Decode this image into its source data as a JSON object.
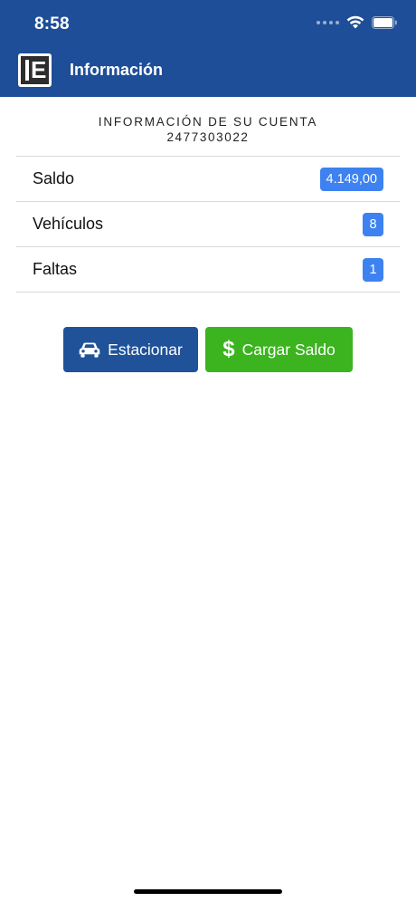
{
  "status_bar": {
    "time": "8:58"
  },
  "app_bar": {
    "title": "Información",
    "logo_letter": "E"
  },
  "account": {
    "label": "INFORMACIÓN DE SU CUENTA",
    "number": "2477303022"
  },
  "rows": [
    {
      "label": "Saldo",
      "value": "4.149,00"
    },
    {
      "label": "Vehículos",
      "value": "8"
    },
    {
      "label": "Faltas",
      "value": "1"
    }
  ],
  "buttons": {
    "estacionar": {
      "label": "Estacionar",
      "icon": "car-icon"
    },
    "cargar_saldo": {
      "label": "Cargar Saldo",
      "icon": "dollar-icon",
      "glyph": "$"
    }
  },
  "colors": {
    "header": "#1f4e98",
    "badge": "#3d82f0",
    "estacionar": "#1f5298",
    "cargar_saldo": "#3bb420"
  }
}
